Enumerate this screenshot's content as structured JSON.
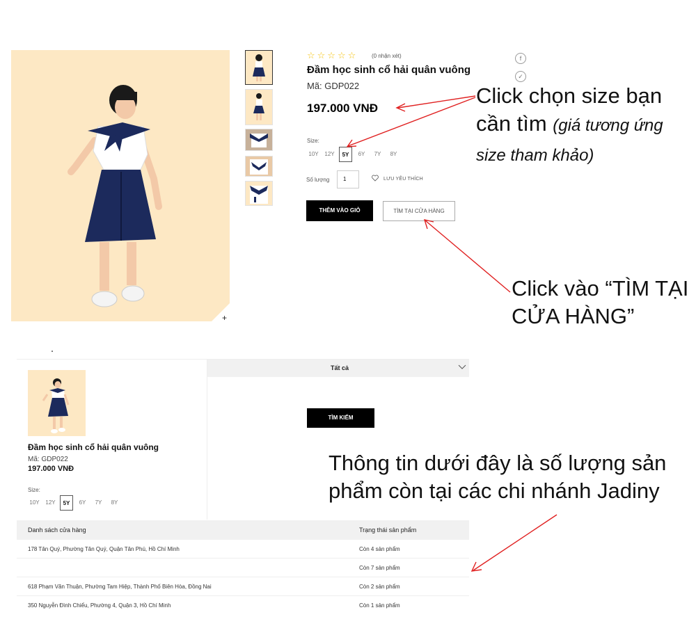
{
  "product": {
    "review_count": "(0 nhận xét)",
    "title": "Đầm học sinh cổ hải quân vuông",
    "code": "Mã: GDP022",
    "price": "197.000 VNĐ",
    "size_label": "Size:",
    "sizes": [
      "10Y",
      "12Y",
      "5Y",
      "6Y",
      "7Y",
      "8Y"
    ],
    "selected_size": "5Y",
    "quantity_label": "Số lượng",
    "quantity_value": "1",
    "wishlist_label": "LƯU YÊU THÍCH",
    "add_to_cart": "THÊM VÀO GIỎ",
    "find_in_store": "TÌM TẠI CỬA HÀNG",
    "zoom": "+",
    "social_icons": [
      "facebook-icon",
      "twitter-icon"
    ]
  },
  "annotations": {
    "size_hint_main": "Click chọn size bạn",
    "size_hint_line2": "cần tìm",
    "size_hint_italic": "(giá tương ứng",
    "size_hint_italic2": "size tham khảo)",
    "store_hint_line1": "Click vào “TÌM TẠI",
    "store_hint_line2": "CỬA HÀNG”",
    "stock_hint_line1": "Thông tin dưới đây là số lượng sản",
    "stock_hint_line2": "phẩm còn tại các chi nhánh Jadiny"
  },
  "store_finder": {
    "title": "Đầm học sinh cổ hải quân vuông",
    "code": "Mã: GDP022",
    "price": "197.000 VNĐ",
    "size_label": "Size:",
    "sizes": [
      "10Y",
      "12Y",
      "5Y",
      "6Y",
      "7Y",
      "8Y"
    ],
    "selected_size": "5Y",
    "region_select": "Tất cả",
    "search_button": "TÌM KIẾM",
    "table_headers": [
      "Danh sách cửa hàng",
      "Trạng thái sản phẩm"
    ],
    "rows": [
      {
        "address": "178 Tân Quý, Phường Tân Quý, Quận Tân Phú, Hồ Chí Minh",
        "status": "Còn 4 sản phẩm"
      },
      {
        "address": "",
        "status": "Còn 7 sản phẩm"
      },
      {
        "address": "618 Phạm Văn Thuận, Phường Tam Hiệp, Thành Phố Biên Hòa, Đồng Nai",
        "status": "Còn 2 sản phẩm"
      },
      {
        "address": "350 Nguyễn Đình Chiểu, Phường 4, Quận 3, Hồ Chí Minh",
        "status": "Còn 1 sản phẩm"
      }
    ]
  },
  "colors": {
    "photo_bg": "#fde8c4",
    "annotation_arrow": "#e02020",
    "uniform_navy": "#1c2a5c",
    "star": "#f4c20d"
  },
  "rating": {
    "stars_filled": 0,
    "stars_total": 5
  }
}
